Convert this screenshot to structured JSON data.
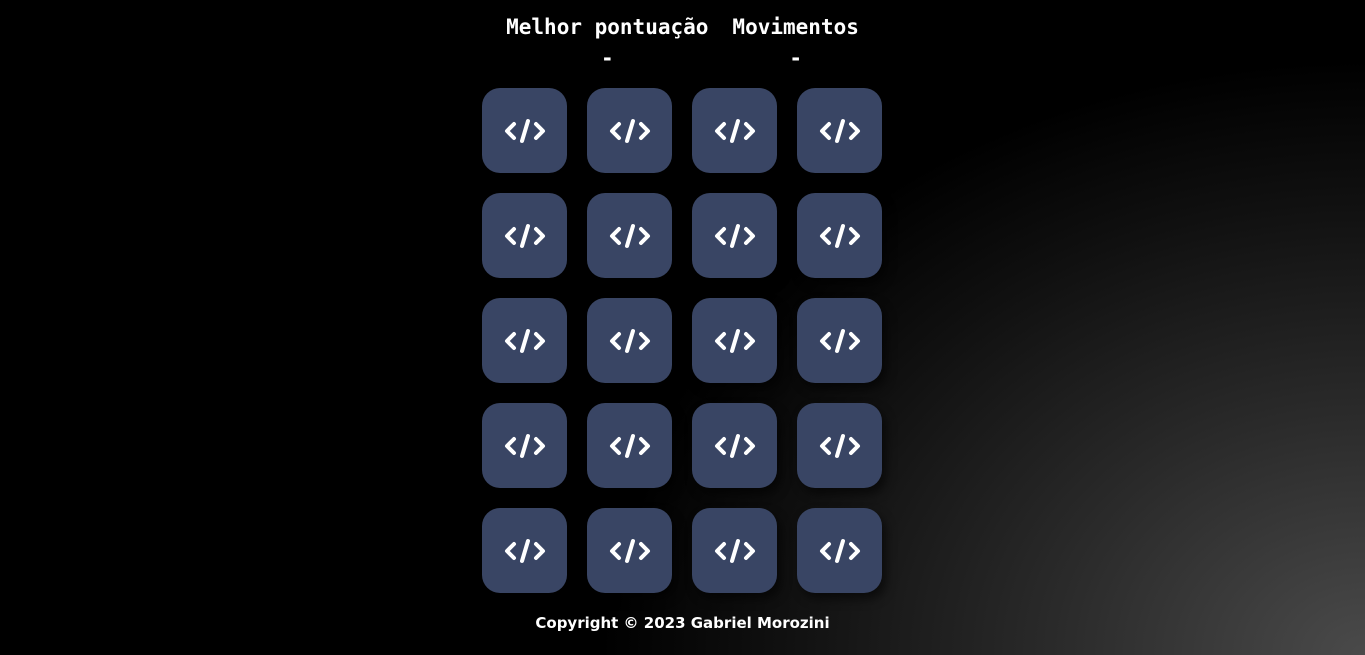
{
  "scoreboard": {
    "best_score_label": "Melhor pontuação",
    "best_score_value": "-",
    "moves_label": "Movimentos",
    "moves_value": "-"
  },
  "board": {
    "rows": 5,
    "columns": 4,
    "card_icon": "code-icon",
    "card_color": "#394564"
  },
  "footer": {
    "copyright": "Copyright © 2023 Gabriel Morozini"
  }
}
